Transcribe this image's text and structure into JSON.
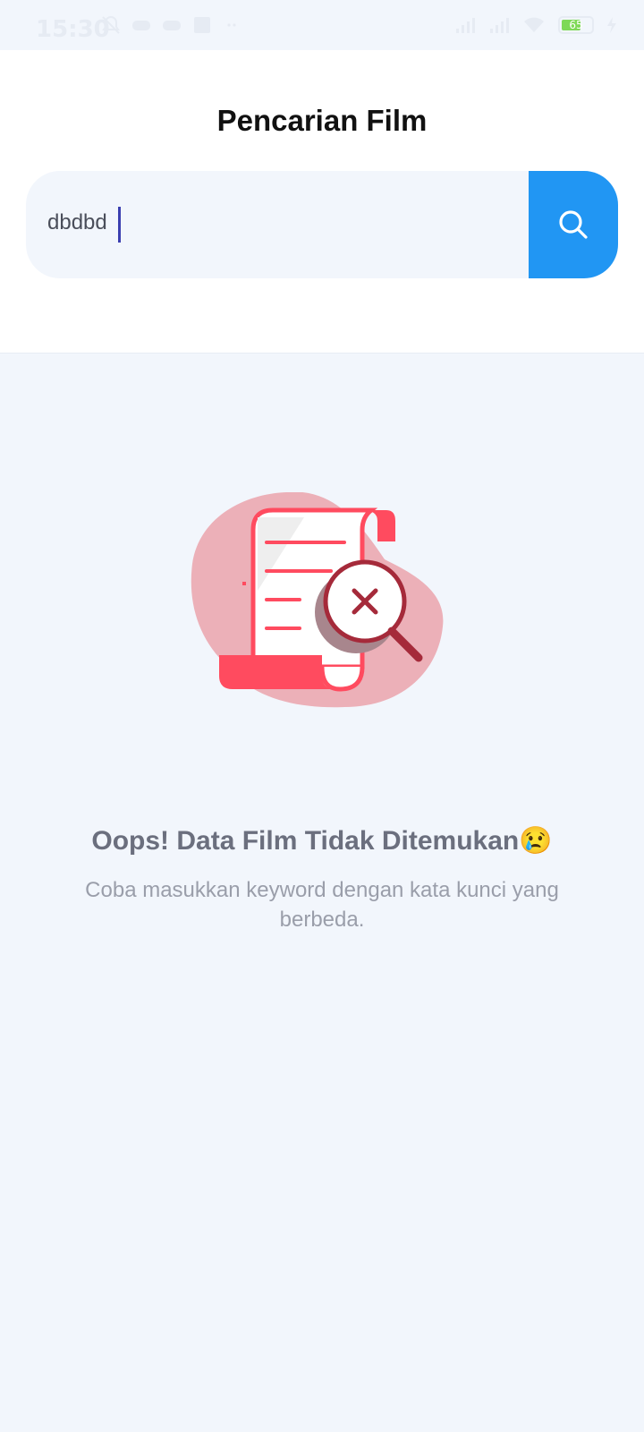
{
  "status_bar": {
    "time": "15:30",
    "battery_level": 65,
    "battery_text": "65",
    "icons": [
      "notification-muted-icon",
      "game-icon",
      "game-controller-icon",
      "screenshot-icon",
      "more-dots-icon",
      "signal-icon",
      "signal-icon",
      "wifi-icon",
      "battery-icon",
      "charging-icon"
    ]
  },
  "header": {
    "title": "Pencarian Film"
  },
  "search": {
    "value": "dbdbd",
    "button_icon": "search-icon"
  },
  "empty_state": {
    "illustration": "document-not-found-illustration",
    "title": "Oops! Data Film Tidak Ditemukan😢",
    "subtitle": "Coba masukkan keyword dengan kata kunci yang berbeda."
  },
  "colors": {
    "accent": "#2196f3",
    "illustration_red": "#ff4b5f",
    "illustration_blob": "#ecb0b8",
    "background": "#f2f6fc"
  }
}
